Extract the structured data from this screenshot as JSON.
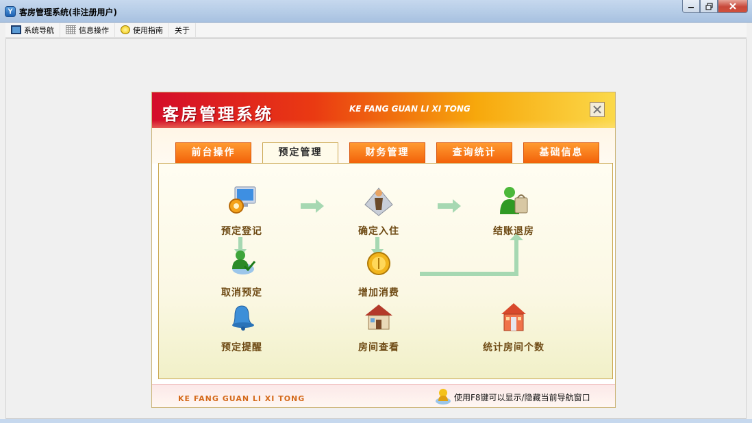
{
  "window": {
    "title": "客房管理系统(非注册用户)",
    "app_icon": "Y"
  },
  "menubar": {
    "items": [
      {
        "label": "系统导航",
        "icon": "monitor-icon"
      },
      {
        "label": "信息操作",
        "icon": "grid-icon"
      },
      {
        "label": "使用指南",
        "icon": "smiley-icon"
      },
      {
        "label": "关于"
      }
    ]
  },
  "navigator": {
    "title": "客房管理系统",
    "subtitle": "KE FANG GUAN LI XI TONG",
    "tabs": [
      "前台操作",
      "预定管理",
      "财务管理",
      "查询统计",
      "基础信息"
    ],
    "active_tab": "预定管理",
    "items": {
      "reservation_register": "预定登记",
      "confirm_checkin": "确定入住",
      "checkout": "结账退房",
      "cancel_reservation": "取消预定",
      "add_consumption": "增加消费",
      "reservation_reminder": "预定提醒",
      "room_view": "房间查看",
      "count_rooms": "统计房间个数"
    },
    "footer": {
      "left": "KE FANG GUAN LI XI TONG",
      "tip": "使用F8键可以显示/隐藏当前导航窗口"
    }
  },
  "colors": {
    "header_red": "#d40d2a",
    "header_yellow": "#fbd94a",
    "tab_orange": "#f2620a",
    "arrow_green": "#a6d8b2",
    "label_brown": "#6e4a14"
  }
}
